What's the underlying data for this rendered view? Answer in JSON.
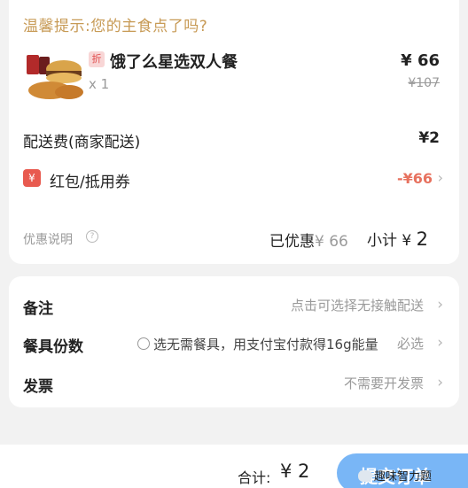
{
  "tip": "温馨提示:您的主食点了吗?",
  "item": {
    "badge": "折",
    "name": "饿了么星选双人餐",
    "qty": "x 1",
    "price": "¥ 66",
    "original_price": "¥107"
  },
  "delivery": {
    "label": "配送费(商家配送)",
    "value": "¥2"
  },
  "hongbao": {
    "icon_text": "¥",
    "label": "红包/抵用券",
    "value": "-¥66"
  },
  "summary": {
    "discount_explain": "优惠说明",
    "saved_label": "已优惠",
    "saved_value": "¥ 66",
    "subtotal_label": "小计 ¥",
    "subtotal_value": "2"
  },
  "options": {
    "remark_label": "备注",
    "remark_value": "点击可选择无接触配送",
    "cutlery_label": "餐具份数",
    "cutlery_note": "选无需餐具，用支付宝付款得16g能量",
    "cutlery_value": "必选",
    "invoice_label": "发票",
    "invoice_value": "不需要开发票"
  },
  "footer": {
    "total_label": "合计:",
    "total_value": "¥ 2",
    "submit_label": "提交订单",
    "watermark": "趣味智力题"
  },
  "colors": {
    "tip": "#c79a55",
    "accent_red": "#e7725f",
    "submit": "#79b6f6"
  }
}
